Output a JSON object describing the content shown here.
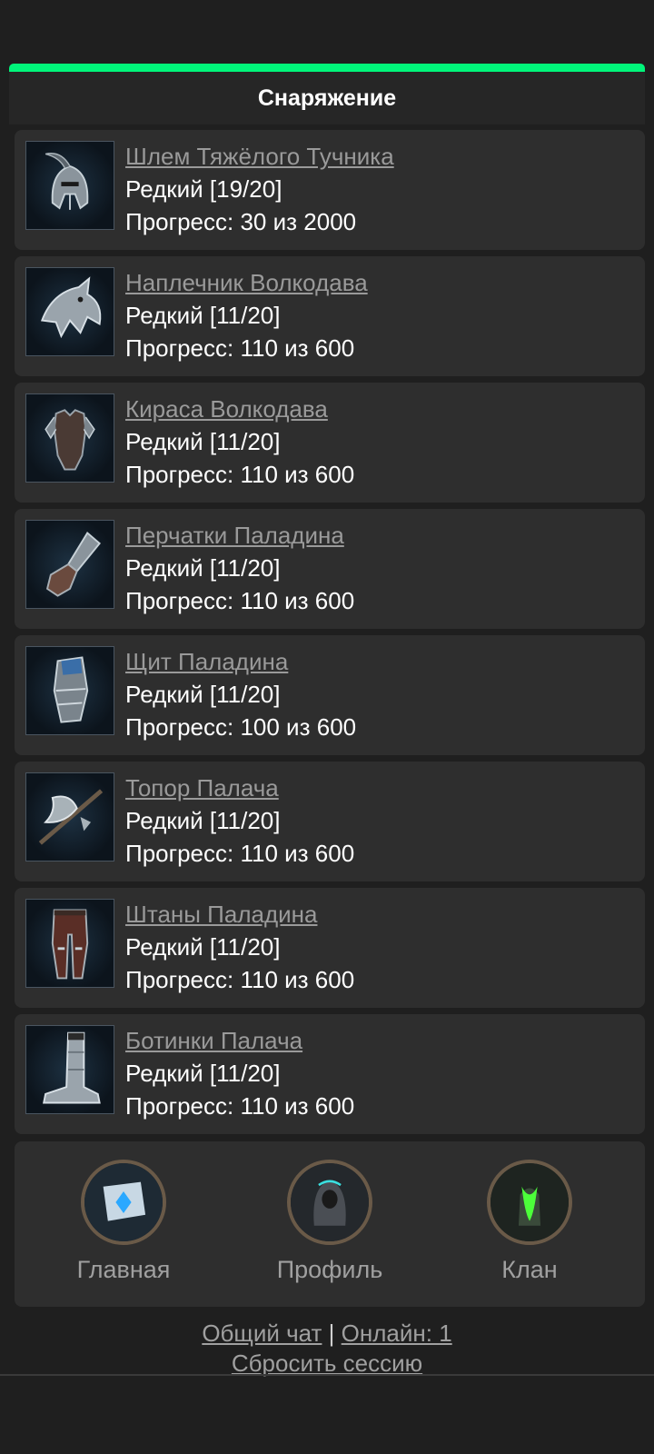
{
  "colors": {
    "accent": "#00f57a",
    "card": "#2e2e2e",
    "background": "#1f1f1f"
  },
  "header": {
    "title": "Снаряжение"
  },
  "items": [
    {
      "name": "Шлем Тяжёлого Тучника",
      "rarity": "Редкий [19/20]",
      "progress": "Прогресс: 30 из 2000",
      "icon": "helmet-icon"
    },
    {
      "name": "Наплечник Волкодава",
      "rarity": "Редкий [11/20]",
      "progress": "Прогресс: 110 из 600",
      "icon": "pauldron-icon"
    },
    {
      "name": "Кираса Волкодава",
      "rarity": "Редкий [11/20]",
      "progress": "Прогресс: 110 из 600",
      "icon": "cuirass-icon"
    },
    {
      "name": "Перчатки Паладина",
      "rarity": "Редкий [11/20]",
      "progress": "Прогресс: 110 из 600",
      "icon": "gauntlet-icon"
    },
    {
      "name": "Щит Паладина",
      "rarity": "Редкий [11/20]",
      "progress": "Прогресс: 100 из 600",
      "icon": "shield-icon"
    },
    {
      "name": "Топор Палача",
      "rarity": "Редкий [11/20]",
      "progress": "Прогресс: 110 из 600",
      "icon": "axe-icon"
    },
    {
      "name": "Штаны Паладина",
      "rarity": "Редкий [11/20]",
      "progress": "Прогресс: 110 из 600",
      "icon": "pants-icon"
    },
    {
      "name": "Ботинки Палача",
      "rarity": "Редкий [11/20]",
      "progress": "Прогресс: 110 из 600",
      "icon": "boots-icon"
    }
  ],
  "nav": {
    "home": "Главная",
    "profile": "Профиль",
    "clan": "Клан"
  },
  "footer": {
    "chat": "Общий чат",
    "separator": "|",
    "online": "Онлайн: 1",
    "reset": "Сбросить сессию"
  }
}
